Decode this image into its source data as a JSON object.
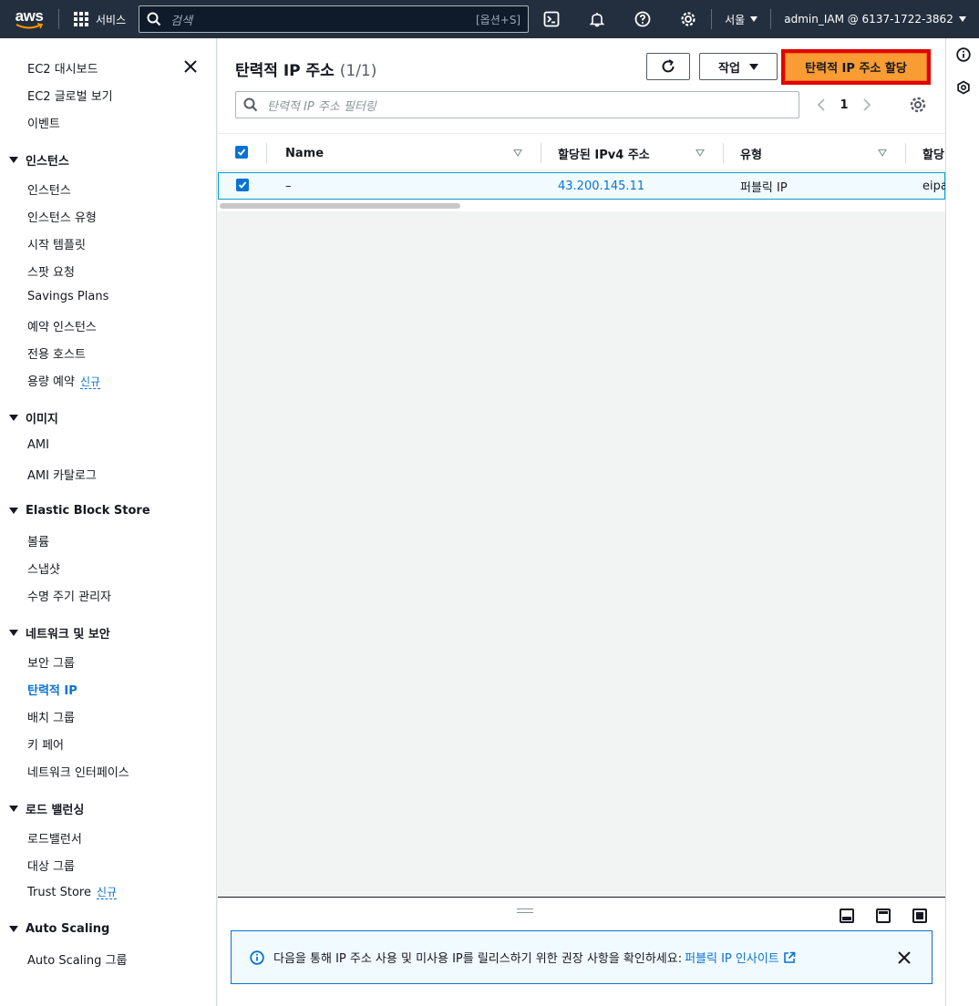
{
  "topnav": {
    "logo_text": "aws",
    "services_label": "서비스",
    "search_placeholder": "검색",
    "search_shortcut": "[옵션+S]",
    "region": "서울",
    "account": "admin_IAM @ 6137-1722-3862",
    "icons": [
      "cloudshell-icon",
      "bell-icon",
      "help-icon",
      "gear-icon"
    ]
  },
  "sidebar": {
    "top_items": [
      "EC2 대시보드",
      "EC2 글로벌 보기",
      "이벤트"
    ],
    "sections": [
      {
        "title": "인스턴스",
        "items": [
          "인스턴스",
          "인스턴스 유형",
          "시작 템플릿",
          "스팟 요청",
          "Savings Plans",
          "예약 인스턴스",
          "전용 호스트",
          "용량 예약"
        ]
      },
      {
        "title": "이미지",
        "items": [
          "AMI",
          "AMI 카탈로그"
        ]
      },
      {
        "title": "Elastic Block Store",
        "items": [
          "볼륨",
          "스냅샷",
          "수명 주기 관리자"
        ]
      },
      {
        "title": "네트워크 및 보안",
        "items": [
          "보안 그룹",
          "탄력적 IP",
          "배치 그룹",
          "키 페어",
          "네트워크 인터페이스"
        ]
      },
      {
        "title": "로드 밸런싱",
        "items": [
          "로드밸런서",
          "대상 그룹",
          "Trust Store"
        ]
      },
      {
        "title": "Auto Scaling",
        "items": [
          "Auto Scaling 그룹"
        ]
      }
    ],
    "new_badge": "신규",
    "active_item": "탄력적 IP"
  },
  "main": {
    "title": "탄력적 IP 주소",
    "count": "(1/1)",
    "actions_label": "작업",
    "allocate_label": "탄력적 IP 주소 할당",
    "filter_placeholder": "탄력적 IP 주소 필터링",
    "page_number": "1",
    "table": {
      "columns": [
        "Name",
        "할당된 IPv4 주소",
        "유형",
        "할당"
      ],
      "rows": [
        {
          "name": "–",
          "ipv4": "43.200.145.11",
          "type": "퍼블릭 IP",
          "allocation": "eipa"
        }
      ]
    }
  },
  "split_panel": {
    "alert_text": "다음을 통해 IP 주소 사용 및 미사용 IP를 릴리스하기 위한 권장 사항을 확인하세요:",
    "alert_link": "퍼블릭 IP 인사이트"
  },
  "colors": {
    "nav_bg": "#232f3e",
    "link": "#0972d3",
    "primary_button": "#f89c33",
    "highlight_border": "#e20000"
  }
}
